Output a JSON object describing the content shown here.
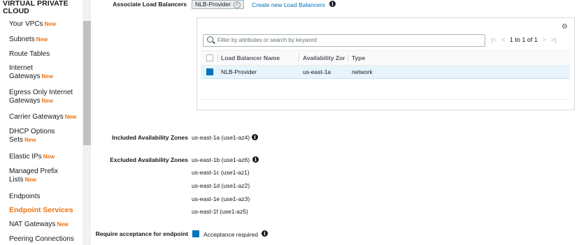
{
  "sidebar": {
    "heading": "VIRTUAL PRIVATE CLOUD",
    "new_badge": "New",
    "items": [
      {
        "label": "Your VPCs",
        "new": true
      },
      {
        "label": "Subnets",
        "new": true
      },
      {
        "label": "Route Tables",
        "new": false
      },
      {
        "label": "Internet Gateways",
        "new": true
      },
      {
        "label": "Egress Only Internet Gateways",
        "new": true
      },
      {
        "label": "Carrier Gateways",
        "new": true
      },
      {
        "label": "DHCP Options Sets",
        "new": true
      },
      {
        "label": "Elastic IPs",
        "new": true
      },
      {
        "label": "Managed Prefix Lists",
        "new": true
      },
      {
        "label": "Endpoints",
        "new": false
      },
      {
        "label": "Endpoint Services",
        "new": false,
        "active": true
      },
      {
        "label": "NAT Gateways",
        "new": true
      },
      {
        "label": "Peering Connections",
        "new": false
      }
    ]
  },
  "associate": {
    "label": "Associate Load Balancers",
    "selected_tag": "NLB-Provider",
    "create_link": "Create new Load Balancers"
  },
  "table": {
    "filter_placeholder": "Filter by attributes or search by keyword",
    "pager": {
      "first": "|<",
      "prev": "<",
      "count": "1 to 1 of 1",
      "next": ">",
      "last": ">|"
    },
    "columns": [
      "Load Balancer Name",
      "Availability Zor",
      "Type"
    ],
    "rows": [
      {
        "name": "NLB-Provider",
        "az": "us-east-1a",
        "type": "network",
        "selected": true
      }
    ]
  },
  "included_zones": {
    "label": "Included Availability Zones",
    "values": [
      "us-east-1a (use1-az4)"
    ]
  },
  "excluded_zones": {
    "label": "Excluded Availability Zones",
    "values": [
      "us-east-1b (use1-az6)",
      "us-east-1c (use1-az1)",
      "us-east-1d (use1-az2)",
      "us-east-1e (use1-az3)",
      "us-east-1f (use1-az5)"
    ]
  },
  "acceptance": {
    "label": "Require acceptance for endpoint",
    "checkbox_label": "Acceptance required",
    "checked": true
  },
  "colors": {
    "accent": "#ec7211",
    "link": "#0073bb",
    "selected_row": "#e8f4fb"
  }
}
